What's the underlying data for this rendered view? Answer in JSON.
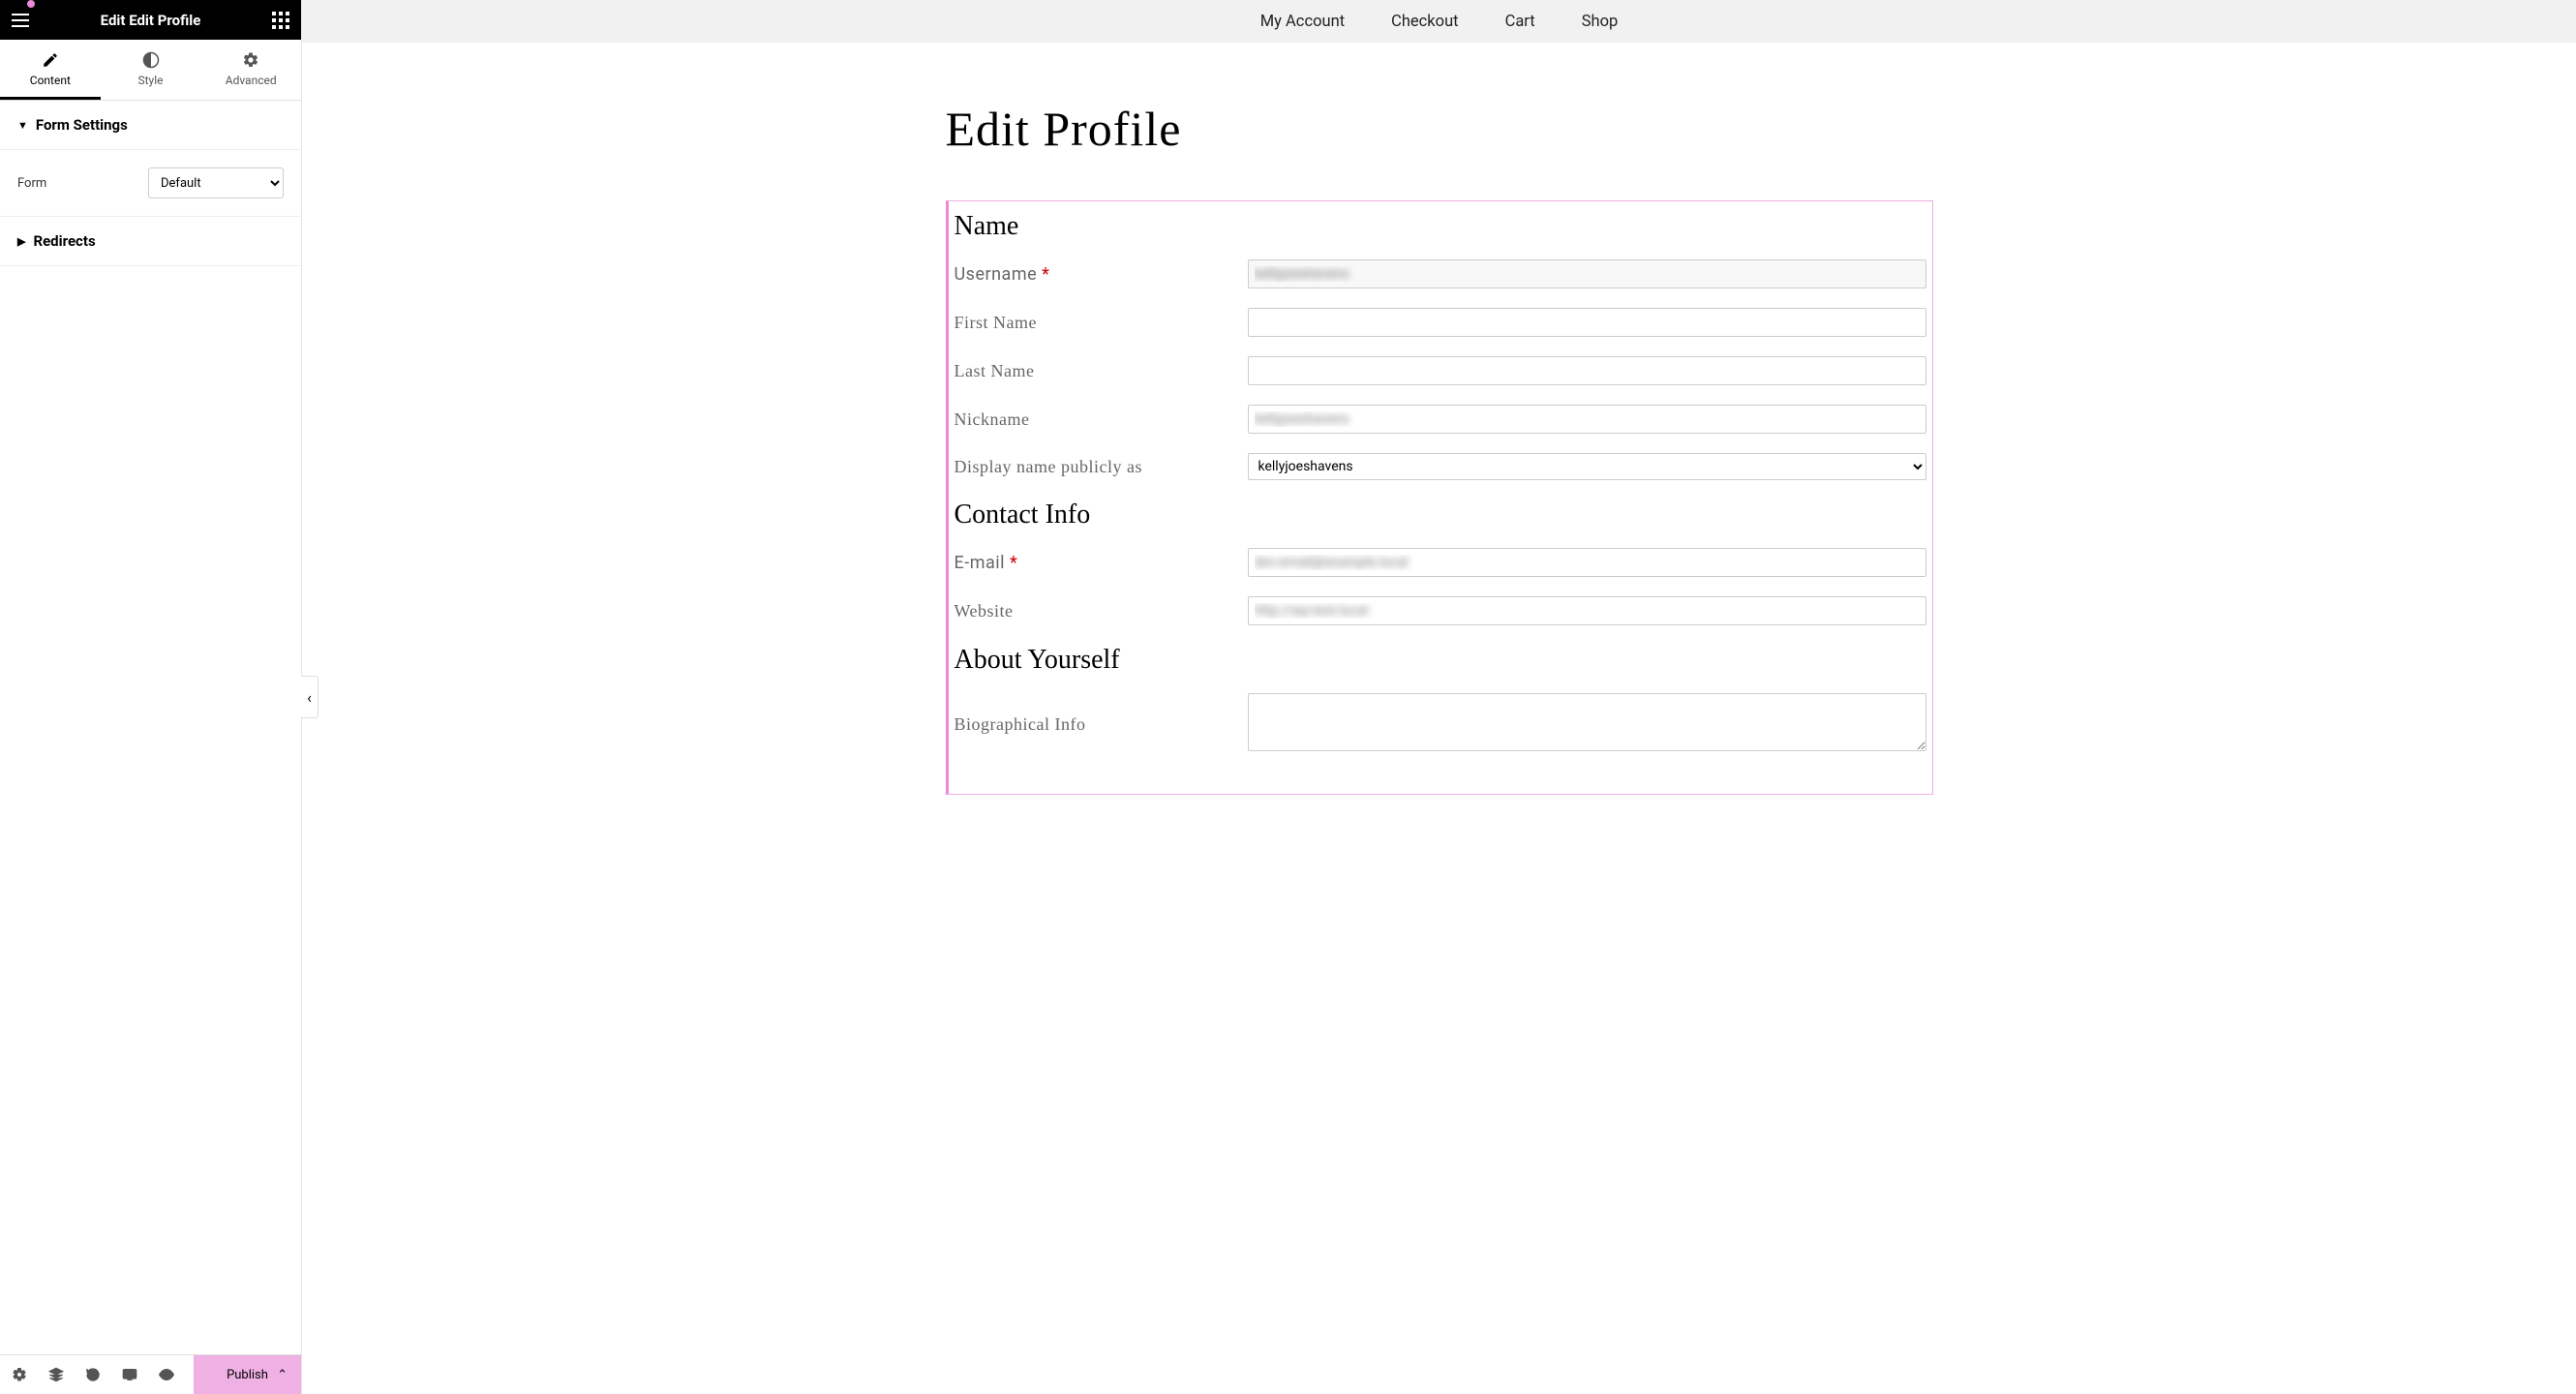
{
  "panel": {
    "title": "Edit Edit Profile",
    "tabs": {
      "content": "Content",
      "style": "Style",
      "advanced": "Advanced"
    },
    "sections": {
      "formSettings": "Form Settings",
      "redirects": "Redirects"
    },
    "formControl": {
      "label": "Form",
      "value": "Default"
    },
    "publish": "Publish"
  },
  "topnav": {
    "account": "My Account",
    "checkout": "Checkout",
    "cart": "Cart",
    "shop": "Shop"
  },
  "page": {
    "title": "Edit Profile",
    "sections": {
      "name": "Name",
      "contact": "Contact Info",
      "about": "About Yourself"
    },
    "fields": {
      "username": {
        "label": "Username",
        "required": true,
        "value": "kellyjoeshavens"
      },
      "first": {
        "label": "First Name",
        "value": ""
      },
      "last": {
        "label": "Last Name",
        "value": ""
      },
      "nickname": {
        "label": "Nickname",
        "value": "kellyjoeshavens"
      },
      "display": {
        "label": "Display name publicly as",
        "value": "kellyjoeshavens"
      },
      "email": {
        "label": "E-mail",
        "required": true,
        "value": "dev-email@example.local"
      },
      "website": {
        "label": "Website",
        "value": "http://wp-test.local"
      },
      "bio": {
        "label": "Biographical Info",
        "value": ""
      }
    }
  }
}
